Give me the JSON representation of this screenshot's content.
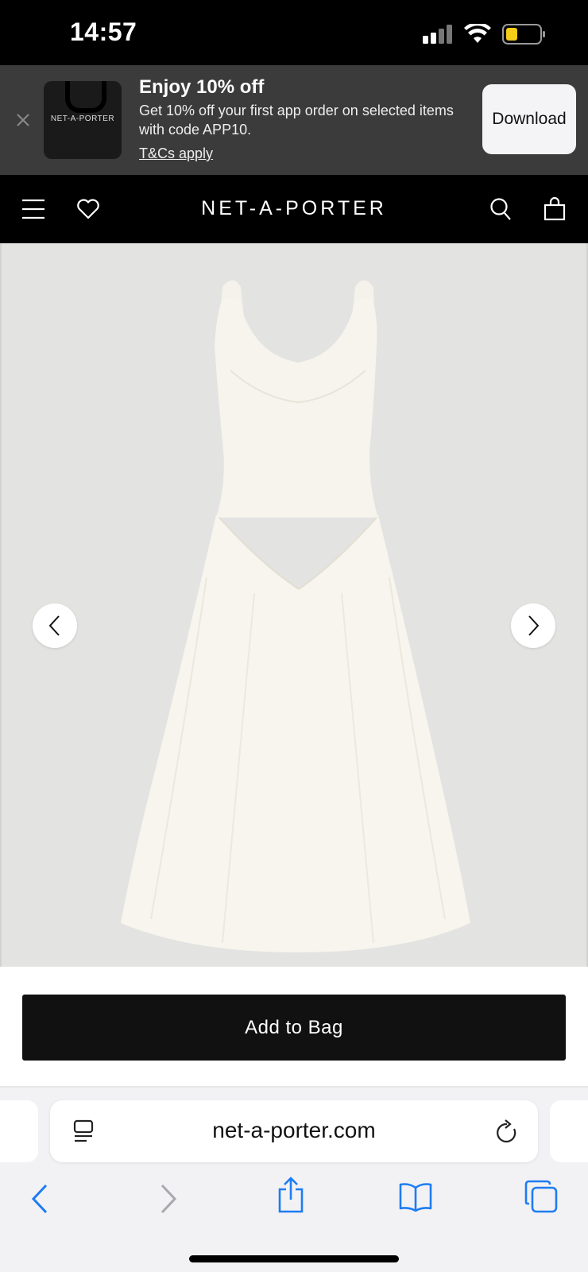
{
  "status_bar": {
    "time": "14:57",
    "battery_level": 0.3
  },
  "promo": {
    "logo_text": "NET-A-PORTER",
    "title": "Enjoy 10% off",
    "body": "Get 10% off your first app order on selected items with code APP10.",
    "terms": "T&Cs apply",
    "download_label": "Download"
  },
  "header": {
    "brand": "NET-A-PORTER"
  },
  "product": {
    "add_to_bag_label": "Add to Bag"
  },
  "browser": {
    "url": "net-a-porter.com"
  },
  "colors": {
    "header_bg": "#000000",
    "promo_bg": "#3a3b3a",
    "button_bg": "#111111",
    "safari_blue": "#1e7cf2"
  }
}
